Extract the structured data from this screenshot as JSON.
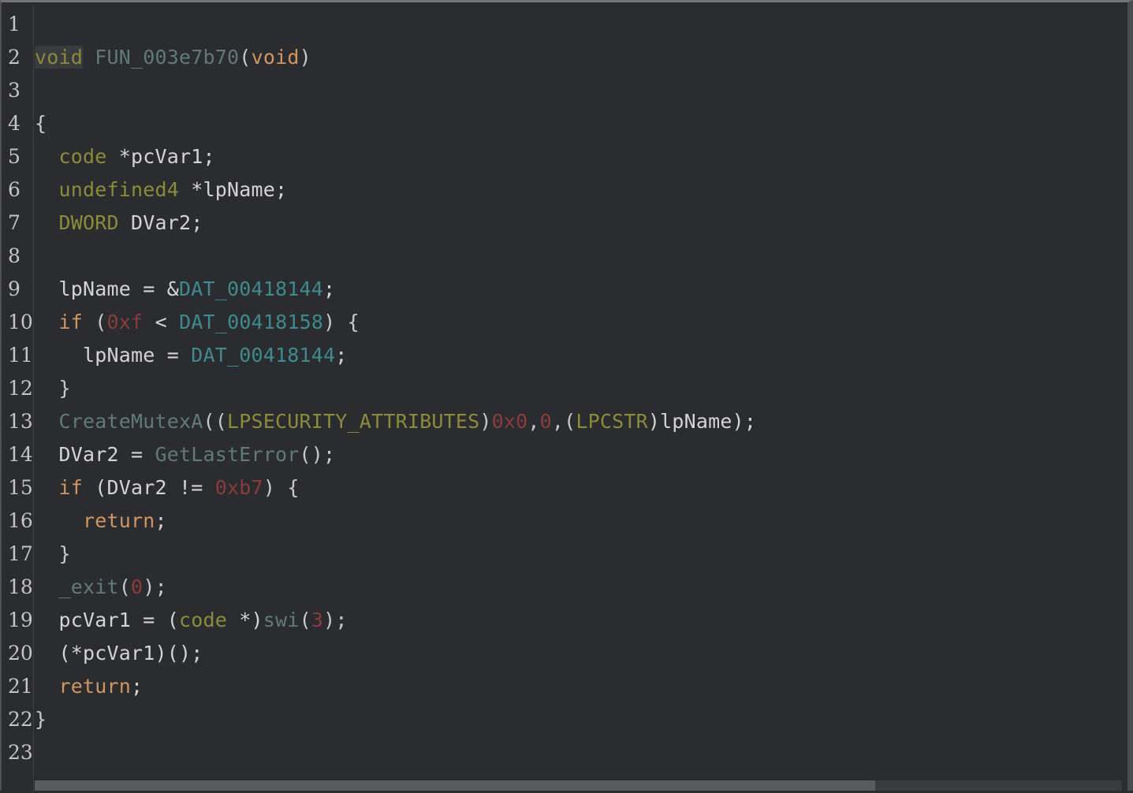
{
  "editor": {
    "lines": [
      {
        "n": "1",
        "tokens": []
      },
      {
        "n": "2",
        "tokens": [
          {
            "t": "void",
            "c": "c-type",
            "hl": true
          },
          {
            "t": " ",
            "c": "c-default"
          },
          {
            "t": "FUN_003e7b70",
            "c": "c-func"
          },
          {
            "t": "(",
            "c": "c-punct"
          },
          {
            "t": "void",
            "c": "c-kw"
          },
          {
            "t": ")",
            "c": "c-punct"
          }
        ]
      },
      {
        "n": "3",
        "tokens": []
      },
      {
        "n": "4",
        "tokens": [
          {
            "t": "{",
            "c": "c-punct"
          }
        ]
      },
      {
        "n": "5",
        "tokens": [
          {
            "t": "  ",
            "c": "c-default"
          },
          {
            "t": "code",
            "c": "c-type"
          },
          {
            "t": " *pcVar1;",
            "c": "c-default"
          }
        ]
      },
      {
        "n": "6",
        "tokens": [
          {
            "t": "  ",
            "c": "c-default"
          },
          {
            "t": "undefined4",
            "c": "c-type"
          },
          {
            "t": " *lpName;",
            "c": "c-default"
          }
        ]
      },
      {
        "n": "7",
        "tokens": [
          {
            "t": "  ",
            "c": "c-default"
          },
          {
            "t": "DWORD",
            "c": "c-type"
          },
          {
            "t": " DVar2;",
            "c": "c-default"
          }
        ]
      },
      {
        "n": "8",
        "tokens": []
      },
      {
        "n": "9",
        "tokens": [
          {
            "t": "  lpName = &",
            "c": "c-default"
          },
          {
            "t": "DAT_00418144",
            "c": "c-data"
          },
          {
            "t": ";",
            "c": "c-default"
          }
        ]
      },
      {
        "n": "10",
        "tokens": [
          {
            "t": "  ",
            "c": "c-default"
          },
          {
            "t": "if",
            "c": "c-kw"
          },
          {
            "t": " (",
            "c": "c-punct"
          },
          {
            "t": "0xf",
            "c": "c-num"
          },
          {
            "t": " < ",
            "c": "c-default"
          },
          {
            "t": "DAT_00418158",
            "c": "c-data"
          },
          {
            "t": ") {",
            "c": "c-punct"
          }
        ]
      },
      {
        "n": "11",
        "tokens": [
          {
            "t": "    lpName = ",
            "c": "c-default"
          },
          {
            "t": "DAT_00418144",
            "c": "c-data"
          },
          {
            "t": ";",
            "c": "c-default"
          }
        ]
      },
      {
        "n": "12",
        "tokens": [
          {
            "t": "  }",
            "c": "c-punct"
          }
        ]
      },
      {
        "n": "13",
        "tokens": [
          {
            "t": "  ",
            "c": "c-default"
          },
          {
            "t": "CreateMutexA",
            "c": "c-func"
          },
          {
            "t": "((",
            "c": "c-punct"
          },
          {
            "t": "LPSECURITY_ATTRIBUTES",
            "c": "c-type"
          },
          {
            "t": ")",
            "c": "c-punct"
          },
          {
            "t": "0x0",
            "c": "c-num"
          },
          {
            "t": ",",
            "c": "c-punct"
          },
          {
            "t": "0",
            "c": "c-num"
          },
          {
            "t": ",(",
            "c": "c-punct"
          },
          {
            "t": "LPCSTR",
            "c": "c-type"
          },
          {
            "t": ")lpName);",
            "c": "c-default"
          }
        ]
      },
      {
        "n": "14",
        "tokens": [
          {
            "t": "  DVar2 = ",
            "c": "c-default"
          },
          {
            "t": "GetLastError",
            "c": "c-func"
          },
          {
            "t": "();",
            "c": "c-punct"
          }
        ]
      },
      {
        "n": "15",
        "tokens": [
          {
            "t": "  ",
            "c": "c-default"
          },
          {
            "t": "if",
            "c": "c-kw"
          },
          {
            "t": " (DVar2 != ",
            "c": "c-default"
          },
          {
            "t": "0xb7",
            "c": "c-num"
          },
          {
            "t": ") {",
            "c": "c-punct"
          }
        ]
      },
      {
        "n": "16",
        "tokens": [
          {
            "t": "    ",
            "c": "c-default"
          },
          {
            "t": "return",
            "c": "c-kw"
          },
          {
            "t": ";",
            "c": "c-default"
          }
        ]
      },
      {
        "n": "17",
        "tokens": [
          {
            "t": "  }",
            "c": "c-punct"
          }
        ]
      },
      {
        "n": "18",
        "tokens": [
          {
            "t": "  ",
            "c": "c-default"
          },
          {
            "t": "_exit",
            "c": "c-func"
          },
          {
            "t": "(",
            "c": "c-punct"
          },
          {
            "t": "0",
            "c": "c-num"
          },
          {
            "t": ");",
            "c": "c-punct"
          }
        ]
      },
      {
        "n": "19",
        "tokens": [
          {
            "t": "  pcVar1 = (",
            "c": "c-default"
          },
          {
            "t": "code",
            "c": "c-type"
          },
          {
            "t": " *)",
            "c": "c-default"
          },
          {
            "t": "swi",
            "c": "c-func"
          },
          {
            "t": "(",
            "c": "c-punct"
          },
          {
            "t": "3",
            "c": "c-num"
          },
          {
            "t": ");",
            "c": "c-punct"
          }
        ]
      },
      {
        "n": "20",
        "tokens": [
          {
            "t": "  (*pcVar1)();",
            "c": "c-default"
          }
        ]
      },
      {
        "n": "21",
        "tokens": [
          {
            "t": "  ",
            "c": "c-default"
          },
          {
            "t": "return",
            "c": "c-kw"
          },
          {
            "t": ";",
            "c": "c-default"
          }
        ]
      },
      {
        "n": "22",
        "tokens": [
          {
            "t": "}",
            "c": "c-punct"
          }
        ]
      },
      {
        "n": "23",
        "tokens": []
      }
    ]
  },
  "colors": {
    "background": "#2b2c2f",
    "type": "#8b8c3a",
    "function": "#5f7a78",
    "keyword": "#d09560",
    "number": "#8a3c3c",
    "data": "#3f8a8e",
    "text": "#d4d4d4"
  }
}
